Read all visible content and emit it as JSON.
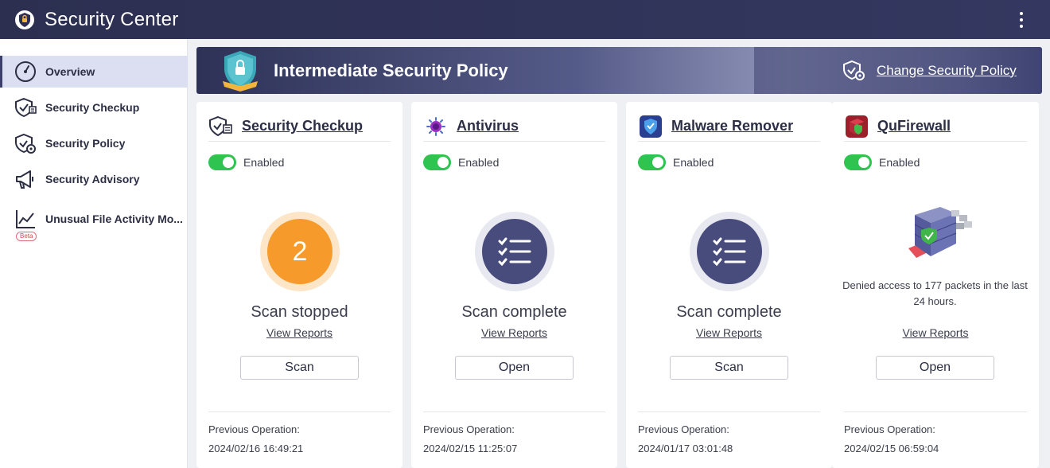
{
  "app": {
    "title": "Security Center"
  },
  "sidebar": {
    "items": [
      {
        "label": "Overview",
        "icon": "gauge-icon",
        "active": true
      },
      {
        "label": "Security Checkup",
        "icon": "shield-check-icon"
      },
      {
        "label": "Security Policy",
        "icon": "shield-gear-icon"
      },
      {
        "label": "Security Advisory",
        "icon": "megaphone-icon"
      },
      {
        "label": "Unusual File Activity Mo...",
        "icon": "line-chart-icon",
        "badge": "Beta"
      }
    ]
  },
  "banner": {
    "title": "Intermediate Security Policy",
    "change_label": "Change Security Policy"
  },
  "cards": [
    {
      "title": "Security Checkup",
      "icon": "shield-check-icon",
      "toggle_label": "Enabled",
      "status_count": "2",
      "status": "Scan stopped",
      "view_reports": "View Reports",
      "action": "Scan",
      "previous_label": "Previous Operation:",
      "previous_time": "2024/02/16 16:49:21"
    },
    {
      "title": "Antivirus",
      "icon": "antivirus-icon",
      "toggle_label": "Enabled",
      "status": "Scan complete",
      "view_reports": "View Reports",
      "action": "Open",
      "previous_label": "Previous Operation:",
      "previous_time": "2024/02/15 11:25:07"
    },
    {
      "title": "Malware Remover",
      "icon": "malware-remover-icon",
      "toggle_label": "Enabled",
      "status": "Scan complete",
      "view_reports": "View Reports",
      "action": "Scan",
      "previous_label": "Previous Operation:",
      "previous_time": "2024/01/17 03:01:48"
    },
    {
      "title": "QuFirewall",
      "icon": "firewall-icon",
      "toggle_label": "Enabled",
      "description": "Denied access to 177 packets in the last 24 hours.",
      "view_reports": "View Reports",
      "action": "Open",
      "previous_label": "Previous Operation:",
      "previous_time": "2024/02/15 06:59:04"
    }
  ],
  "colors": {
    "accent": "#343860",
    "enabled": "#2fc34f",
    "warning": "#f59a2b"
  }
}
